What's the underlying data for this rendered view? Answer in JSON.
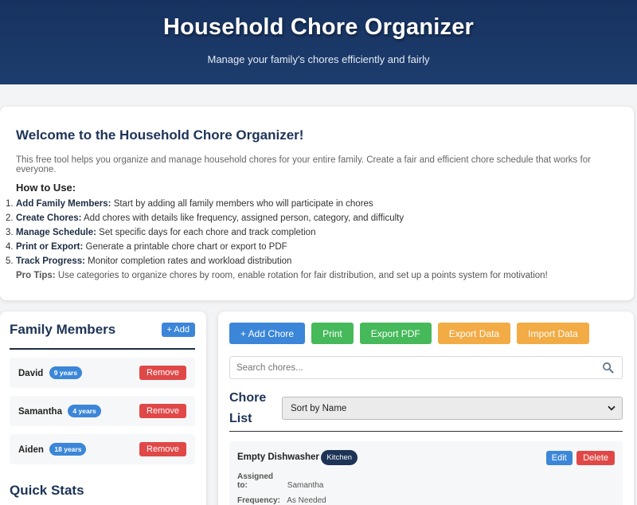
{
  "header": {
    "title": "Household Chore Organizer",
    "subtitle": "Manage your family's chores efficiently and fairly"
  },
  "welcome": {
    "title": "Welcome to the Household Chore Organizer!",
    "intro": "This free tool helps you organize and manage household chores for your entire family. Create a fair and efficient chore schedule that works for everyone.",
    "how_to_title": "How to Use:",
    "steps": [
      {
        "num": "1.",
        "bold": "Add Family Members:",
        "text": " Start by adding all family members who will participate in chores"
      },
      {
        "num": "2.",
        "bold": "Create Chores:",
        "text": " Add chores with details like frequency, assigned person, category, and difficulty"
      },
      {
        "num": "3.",
        "bold": "Manage Schedule:",
        "text": " Set specific days for each chore and track completion"
      },
      {
        "num": "4.",
        "bold": "Print or Export:",
        "text": " Generate a printable chore chart or export to PDF"
      },
      {
        "num": "5.",
        "bold": "Track Progress:",
        "text": " Monitor completion rates and workload distribution"
      }
    ],
    "tips_label": "Pro Tips:",
    "tips_text": " Use categories to organize chores by room, enable rotation for fair distribution, and set up a points system for motivation!"
  },
  "family": {
    "title": "Family Members",
    "add_label": "+ Add",
    "remove_label": "Remove",
    "members": [
      {
        "name": "David",
        "age": "9 years"
      },
      {
        "name": "Samantha",
        "age": "4 years"
      },
      {
        "name": "Aiden",
        "age": "18 years"
      }
    ],
    "stats_title": "Quick Stats"
  },
  "toolbar": {
    "add_chore": "+ Add Chore",
    "print": "Print",
    "export_pdf": "Export PDF",
    "export_data": "Export Data",
    "import_data": "Import Data"
  },
  "search": {
    "placeholder": "Search chores..."
  },
  "chore_list": {
    "title": "Chore List",
    "sort_selected": "Sort by Name"
  },
  "chores": [
    {
      "title": "Empty Dishwasher",
      "category": "Kitchen",
      "edit_label": "Edit",
      "delete_label": "Delete",
      "assigned_label": "Assigned to:",
      "assigned_value": "Samantha",
      "frequency_label": "Frequency:",
      "frequency_value": "As Needed"
    }
  ],
  "icons": {
    "search": "search-icon",
    "dropdown": "chevron-down-icon"
  },
  "colors": {
    "header_bg": "#17325f",
    "primary": "#3b86d8",
    "success": "#46b95a",
    "warning": "#f2ab45",
    "danger": "#e04848",
    "navy": "#1d3457"
  }
}
